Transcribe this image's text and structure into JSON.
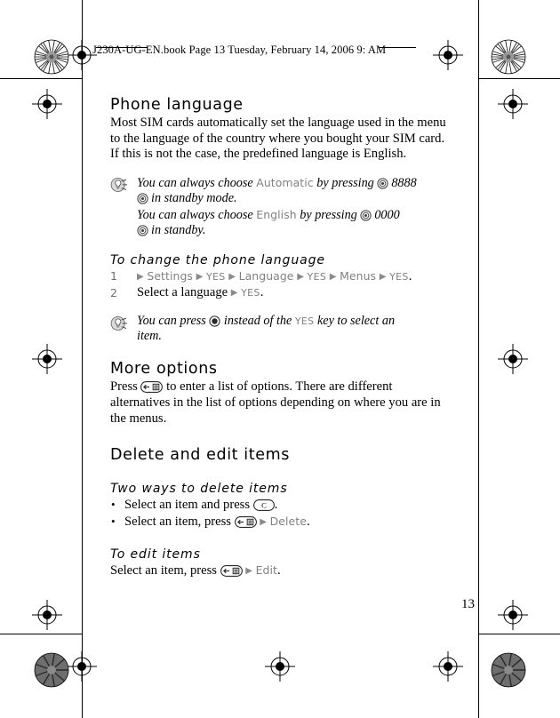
{
  "document": {
    "running_header": "J230A-UG-EN.book  Page 13  Tuesday, February 14, 2006  9:     AM",
    "page_number": "13"
  },
  "sections": {
    "phone_language": {
      "heading": "Phone language",
      "body": "Most SIM cards automatically set the language used in the menu to the language of the country where you bought your SIM card. If this is not the case, the predefined language is English.",
      "tip": {
        "icon": "tip-lightbulb-icon",
        "line1_a": "You can always choose ",
        "line1_ui": "Automatic",
        "line1_b": " by pressing ",
        "line1_key": "joystick-icon",
        "line1_c": "8888",
        "line2_key": "joystick-icon",
        "line2": "in standby mode.",
        "line3_a": "You can always choose ",
        "line3_ui": "English",
        "line3_b": " by pressing ",
        "line3_key": "joystick-icon",
        "line3_c": "0000",
        "line4_key": "joystick-icon",
        "line4": "in standby."
      }
    },
    "change_language": {
      "heading": "To change the phone language",
      "steps": [
        {
          "num": "1",
          "path": [
            "Settings",
            "YES",
            "Language",
            "YES",
            "Menus",
            "YES"
          ],
          "trailing": "."
        },
        {
          "num": "2",
          "text_before": "Select a language ",
          "ui": "YES",
          "trailing": "."
        }
      ],
      "tip": {
        "icon": "tip-lightbulb-icon",
        "line1_a": "You can press ",
        "line1_key": "joystick-icon",
        "line1_b": " instead of the ",
        "line1_ui": "YES",
        "line1_c": " key to select an",
        "line2": "item."
      }
    },
    "more_options": {
      "heading": "More options",
      "text_a": "Press ",
      "key": "options-key-icon",
      "text_b": " to enter a list of options. There are different alternatives in the list of options depending on where you are in the menus."
    },
    "delete_and_edit": {
      "heading": "Delete and edit items",
      "two_ways": {
        "heading": "Two ways to delete items",
        "bullets": [
          {
            "bullet": "•",
            "text_a": "Select an item and press ",
            "key": "clear-key-icon",
            "text_b": "."
          },
          {
            "bullet": "•",
            "text_a": "Select an item, press ",
            "key": "options-key-icon",
            "arrow": "▶",
            "ui": "Delete",
            "text_b": "."
          }
        ]
      },
      "to_edit": {
        "heading": "To edit items",
        "text_a": "Select an item, press ",
        "key": "options-key-icon",
        "arrow": "▶",
        "ui": "Edit",
        "text_b": "."
      }
    }
  },
  "marks": {
    "registration": "registration-crosshair-mark",
    "starburst": "print-density-starburst-mark",
    "arrow_glyph": "▶",
    "clear_key_label": "C"
  },
  "colors": {
    "ui_gray": "#808080",
    "text_black": "#000000",
    "page_background": "#ffffff"
  }
}
